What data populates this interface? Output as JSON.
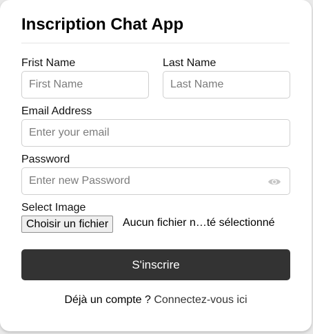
{
  "header": {
    "title": "Inscription Chat App"
  },
  "form": {
    "first_name": {
      "label": "Frist Name",
      "placeholder": "First Name",
      "value": ""
    },
    "last_name": {
      "label": "Last Name",
      "placeholder": "Last Name",
      "value": ""
    },
    "email": {
      "label": "Email Address",
      "placeholder": "Enter your email",
      "value": ""
    },
    "password": {
      "label": "Password",
      "placeholder": "Enter new Password",
      "value": "",
      "toggle_icon": "eye-icon"
    },
    "image": {
      "label": "Select Image",
      "button_label": "Choisir un fichier",
      "status": "Aucun fichier n…té sélectionné"
    },
    "submit_label": "S'inscrire"
  },
  "footer": {
    "text": "Déjà un compte ?",
    "link_label": "Connectez-vous ici"
  },
  "colors": {
    "button_bg": "#333333",
    "button_text": "#ffffff",
    "border": "#cfcfcf"
  }
}
